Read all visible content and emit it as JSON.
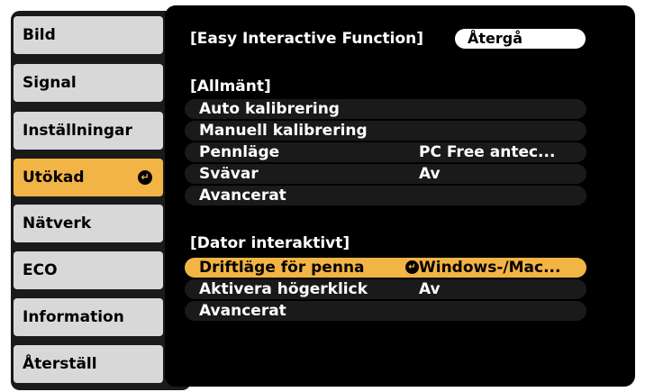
{
  "sidebar": {
    "items": [
      {
        "label": "Bild"
      },
      {
        "label": "Signal"
      },
      {
        "label": "Inställningar"
      },
      {
        "label": "Utökad"
      },
      {
        "label": "Nätverk"
      },
      {
        "label": "ECO"
      },
      {
        "label": "Information"
      },
      {
        "label": "Återställ"
      }
    ],
    "selected_index": 3
  },
  "panel": {
    "title": "[Easy Interactive Function]",
    "back_label": "Återgå",
    "sections": [
      {
        "heading": "[Allmänt]",
        "rows": [
          {
            "label": "Auto kalibrering",
            "value": ""
          },
          {
            "label": "Manuell kalibrering",
            "value": ""
          },
          {
            "label": "Pennläge",
            "value": "PC Free antec..."
          },
          {
            "label": "Svävar",
            "value": "Av"
          },
          {
            "label": "Avancerat",
            "value": ""
          }
        ]
      },
      {
        "heading": "[Dator interaktivt]",
        "rows": [
          {
            "label": "Driftläge för penna",
            "value": "Windows-/Mac..."
          },
          {
            "label": "Aktivera högerklick",
            "value": "Av"
          },
          {
            "label": "Avancerat",
            "value": ""
          }
        ]
      }
    ]
  },
  "colors": {
    "selected": "#f2b445",
    "panel_bg": "#000000",
    "row_bg": "#1a1a1a",
    "sidebar_item": "#d8d8d8"
  }
}
